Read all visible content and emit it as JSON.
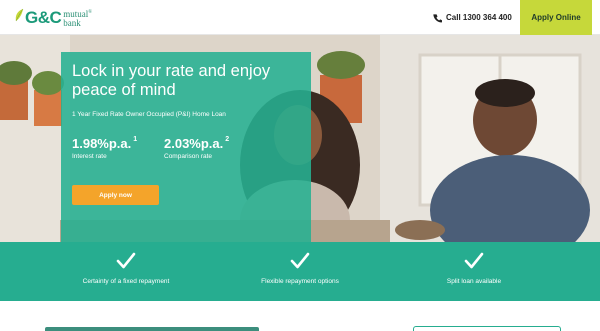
{
  "header": {
    "logo": {
      "brand": "G&C",
      "line1": "mutual",
      "line2": "bank",
      "reg_mark": "®"
    },
    "call_label": "Call 1300 364 400",
    "apply_label": "Apply Online"
  },
  "promo": {
    "title": "Lock in your rate and enjoy peace of mind",
    "subtitle": "1 Year Fixed Rate Owner Occupied (P&I) Home Loan",
    "interest": {
      "value": "1.98%p.a.",
      "footnote": "1",
      "label": "Interest rate"
    },
    "comparison": {
      "value": "2.03%p.a.",
      "footnote": "2",
      "label": "Comparison rate"
    },
    "button_label": "Apply now"
  },
  "features": [
    {
      "icon": "check-icon",
      "label": "Certainty of a fixed repayment"
    },
    {
      "icon": "check-icon",
      "label": "Flexible repayment options"
    },
    {
      "icon": "check-icon",
      "label": "Split loan available"
    }
  ],
  "colors": {
    "brand_green": "#26ad90",
    "promo_panel": "#26b092",
    "apply_online_bg": "#c6d83a",
    "apply_now_bg": "#f4a42a"
  }
}
